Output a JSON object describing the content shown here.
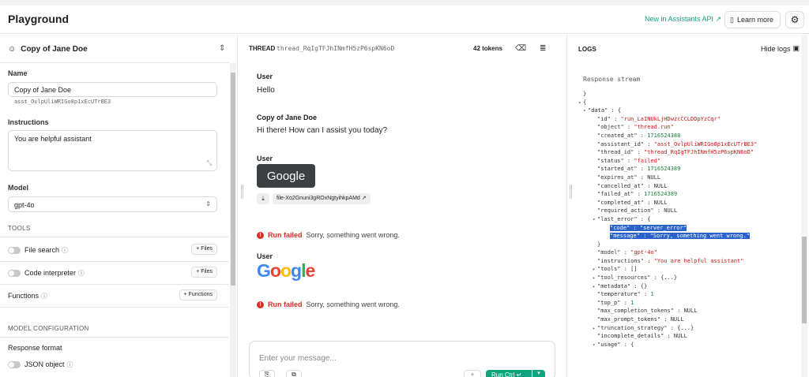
{
  "app": {
    "title": "Playground",
    "new_api_link": "New in Assistants API ↗",
    "learn_more": "Learn more"
  },
  "assistant": {
    "selected_name": "Copy of Jane Doe",
    "name_label": "Name",
    "name_value": "Copy of Jane Doe",
    "id": "asst_OvlpUliWRIGo8p1xEcUTrBE3",
    "instructions_label": "Instructions",
    "instructions_value": "You are helpful assistant",
    "model_label": "Model",
    "model_value": "gpt-4o",
    "tools_label": "TOOLS",
    "tools": [
      {
        "label": "File search",
        "button": "+ Files"
      },
      {
        "label": "Code interpreter",
        "button": "+ Files"
      },
      {
        "label": "Functions",
        "button": "+ Functions"
      }
    ],
    "model_config_label": "MODEL CONFIGURATION",
    "response_format_label": "Response format",
    "json_object_label": "JSON object"
  },
  "thread": {
    "label": "THREAD",
    "id": "thread_RqIgTFJhINmfH5zP6spKN6oD",
    "tokens": "42 tokens",
    "messages": {
      "m1_role": "User",
      "m1_text": "Hello",
      "m2_role": "Copy of Jane Doe",
      "m2_text": "Hi there! How can I assist you today?",
      "m3_role": "User",
      "m3_image_text": "Google",
      "m3_file_name": "file-Xo2Gnuni3gROxNgtyihkpAMd",
      "m4_role": "User",
      "m4_logo": [
        "G",
        "o",
        "o",
        "g",
        "l",
        "e"
      ]
    },
    "error_label": "Run failed",
    "error_text": "Sorry, something went wrong.",
    "composer_placeholder": "Enter your message...",
    "run_button": "Run Ctrl ↵",
    "logo_colors": [
      "#4285f4",
      "#ea4335",
      "#fbbc05",
      "#4285f4",
      "#34a853",
      "#ea4335"
    ]
  },
  "logs": {
    "title": "LOGS",
    "hide_logs": "Hide logs",
    "stream_label": "Response stream",
    "lines": [
      {
        "i": 0,
        "t": "",
        "p": [
          [
            "k",
            "}"
          ]
        ]
      },
      {
        "i": 0,
        "t": "▾",
        "p": [
          [
            "k",
            "{"
          ]
        ]
      },
      {
        "i": 1,
        "t": "▾",
        "p": [
          [
            "k",
            "\"data\" : {"
          ]
        ]
      },
      {
        "i": 2,
        "t": "",
        "p": [
          [
            "k",
            "\"id\" : "
          ],
          [
            "s",
            "\"run_LaINUkLjHDwzcCCLDDpYzCqr\""
          ]
        ]
      },
      {
        "i": 2,
        "t": "",
        "p": [
          [
            "k",
            "\"object\" : "
          ],
          [
            "s",
            "\"thread.run\""
          ]
        ]
      },
      {
        "i": 2,
        "t": "",
        "p": [
          [
            "k",
            "\"created_at\" : "
          ],
          [
            "n",
            "1716524388"
          ]
        ]
      },
      {
        "i": 2,
        "t": "",
        "p": [
          [
            "k",
            "\"assistant_id\" : "
          ],
          [
            "s",
            "\"asst_OvlpUliWRIGo8p1xEcUTrBE3\""
          ]
        ]
      },
      {
        "i": 2,
        "t": "",
        "p": [
          [
            "k",
            "\"thread_id\" : "
          ],
          [
            "s",
            "\"thread_RqIgTFJhINmfH5zP6spKN6oD\""
          ]
        ]
      },
      {
        "i": 2,
        "t": "",
        "p": [
          [
            "k",
            "\"status\" : "
          ],
          [
            "s",
            "\"failed\""
          ]
        ]
      },
      {
        "i": 2,
        "t": "",
        "p": [
          [
            "k",
            "\"started_at\" : "
          ],
          [
            "n",
            "1716524389"
          ]
        ]
      },
      {
        "i": 2,
        "t": "",
        "p": [
          [
            "k",
            "\"expires_at\" : NULL"
          ]
        ]
      },
      {
        "i": 2,
        "t": "",
        "p": [
          [
            "k",
            "\"cancelled_at\" : NULL"
          ]
        ]
      },
      {
        "i": 2,
        "t": "",
        "p": [
          [
            "k",
            "\"failed_at\" : "
          ],
          [
            "n",
            "1716524389"
          ]
        ]
      },
      {
        "i": 2,
        "t": "",
        "p": [
          [
            "k",
            "\"completed_at\" : NULL"
          ]
        ]
      },
      {
        "i": 2,
        "t": "",
        "p": [
          [
            "k",
            "\"required_action\" : NULL"
          ]
        ]
      },
      {
        "i": 2,
        "t": "▾",
        "p": [
          [
            "k",
            "\"last_error\" : {"
          ]
        ]
      },
      {
        "i": 3,
        "t": "",
        "p": [
          [
            "hl",
            "\"code\" : \"server_error\""
          ]
        ]
      },
      {
        "i": 3,
        "t": "",
        "p": [
          [
            "hl",
            "\"message\" : \"Sorry, something went wrong.\""
          ]
        ]
      },
      {
        "i": 2,
        "t": "",
        "p": [
          [
            "k",
            "}"
          ]
        ]
      },
      {
        "i": 2,
        "t": "",
        "p": [
          [
            "k",
            "\"model\" : "
          ],
          [
            "s",
            "\"gpt-4o\""
          ]
        ]
      },
      {
        "i": 2,
        "t": "",
        "p": [
          [
            "k",
            "\"instructions\" : "
          ],
          [
            "s",
            "\"You are helpful assistant\""
          ]
        ]
      },
      {
        "i": 2,
        "t": "▸",
        "p": [
          [
            "k",
            "\"tools\" : []"
          ]
        ]
      },
      {
        "i": 2,
        "t": "▸",
        "p": [
          [
            "k",
            "\"tool_resources\" : {...}"
          ]
        ]
      },
      {
        "i": 2,
        "t": "▸",
        "p": [
          [
            "k",
            "\"metadata\" : {}"
          ]
        ]
      },
      {
        "i": 2,
        "t": "",
        "p": [
          [
            "k",
            "\"temperature\" : "
          ],
          [
            "n",
            "1"
          ]
        ]
      },
      {
        "i": 2,
        "t": "",
        "p": [
          [
            "k",
            "\"top_p\" : "
          ],
          [
            "n",
            "1"
          ]
        ]
      },
      {
        "i": 2,
        "t": "",
        "p": [
          [
            "k",
            "\"max_completion_tokens\" : NULL"
          ]
        ]
      },
      {
        "i": 2,
        "t": "",
        "p": [
          [
            "k",
            "\"max_prompt_tokens\" : NULL"
          ]
        ]
      },
      {
        "i": 2,
        "t": "▸",
        "p": [
          [
            "k",
            "\"truncation_strategy\" : {...}"
          ]
        ]
      },
      {
        "i": 2,
        "t": "",
        "p": [
          [
            "k",
            "\"incomplete_details\" : NULL"
          ]
        ]
      },
      {
        "i": 2,
        "t": "▾",
        "p": [
          [
            "k",
            "\"usage\" : {"
          ]
        ]
      }
    ]
  }
}
